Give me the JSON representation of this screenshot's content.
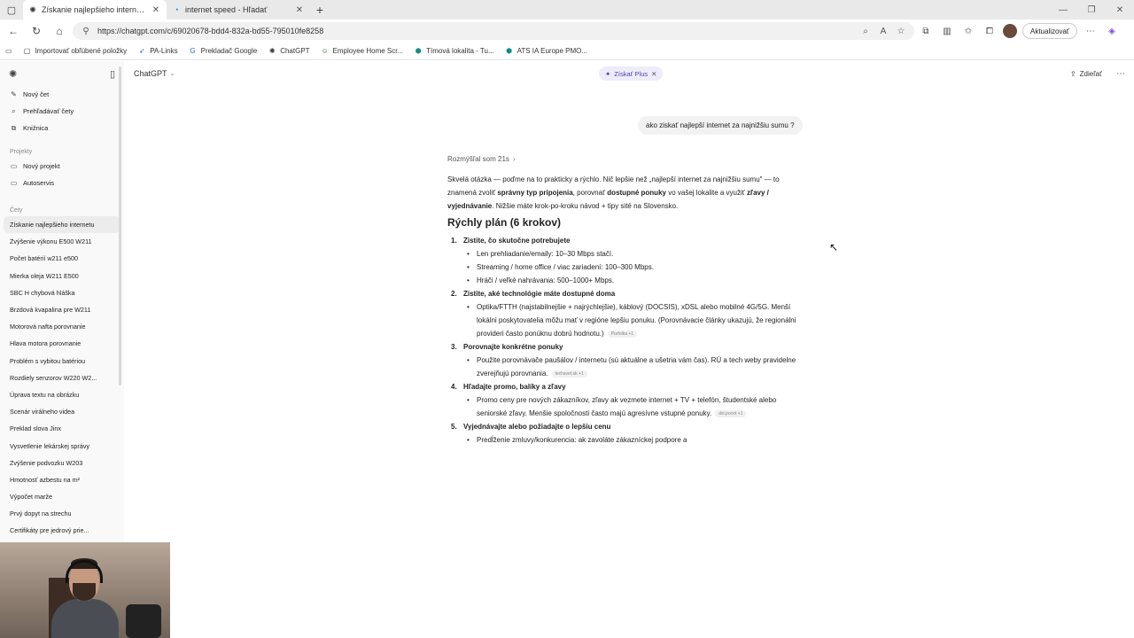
{
  "browser": {
    "tabs": [
      {
        "title": "Získanie najlepšieho internetu",
        "active": true
      },
      {
        "title": "internet speed - Hľadať",
        "active": false
      }
    ],
    "url": "https://chatgpt.com/c/69020678-bdd4-832a-bd55-795010fe8258",
    "update_label": "Aktualizovať"
  },
  "bookmarks": [
    {
      "label": "Importovať obľúbené položky",
      "icon": "folder-icon"
    },
    {
      "label": "PA-Links",
      "icon": "pa-icon"
    },
    {
      "label": "Prekladač Google",
      "icon": "translate-icon"
    },
    {
      "label": "ChatGPT",
      "icon": "chatgpt-icon"
    },
    {
      "label": "Employee Home Scr...",
      "icon": "person-icon"
    },
    {
      "label": "Tímová lokalita - Tu...",
      "icon": "team-icon"
    },
    {
      "label": "ATS IA Europe PMO...",
      "icon": "team-icon"
    }
  ],
  "sidebar": {
    "actions": [
      {
        "label": "Nový čet",
        "icon": "edit-icon"
      },
      {
        "label": "Prehľadávať čety",
        "icon": "search-icon"
      },
      {
        "label": "Knižnica",
        "icon": "library-icon"
      }
    ],
    "projects_heading": "Projekty",
    "projects": [
      {
        "label": "Nový projekt",
        "icon": "folder-plus-icon"
      },
      {
        "label": "Autoservis",
        "icon": "folder-icon"
      }
    ],
    "chats_heading": "Čety",
    "chats": [
      "Získanie najlepšieho internetu",
      "Zvýšenie výkonu E500 W211",
      "Počet batérií w211 e500",
      "Mierka oleja W211 E500",
      "SBC H chybová hláška",
      "Brzdová kvapalina pre W211",
      "Motorová nafta porovnanie",
      "Hlava motora porovnanie",
      "Problém s vybitou batériou",
      "Rozdiely senzorov W220 W2...",
      "Úprava textu na obrázku",
      "Scenár virálneho videa",
      "Preklad slova Jinx",
      "Vysvetlenie lekárskej správy",
      "Zvýšenie podvozku W203",
      "Hmotnosť azbestu na m²",
      "Výpočet marže",
      "Prvý dopyt na strechu",
      "Certifikáty pre jedrový prie..."
    ]
  },
  "header": {
    "model": "ChatGPT",
    "plus_label": "Získať Plus",
    "share_label": "Zdieľať"
  },
  "conversation": {
    "user_message": "ako ziskať najlepší internet za najnižšiu sumu ?",
    "thought": "Rozmýšľal som 21s",
    "intro_1": "Skvelá otázka — poďme na to prakticky a rýchlo. Nič lepšie než „najlepší internet za najnižšiu sumu\" — to znamená zvoliť ",
    "intro_b1": "správny typ pripojenia",
    "intro_2": ", porovnať ",
    "intro_b2": "dostupné ponuky",
    "intro_3": " vo vašej lokalite a využiť ",
    "intro_b3": "zľavy / vyjednávanie",
    "intro_4": ". Nižšie máte krok-po-kroku návod + tipy sité na Slovensko.",
    "plan_heading": "Rýchly plán (6 krokov)",
    "steps": [
      {
        "num": "1.",
        "title": "Zistite, čo skutočne potrebujete",
        "bullets": [
          {
            "text": "Len prehliadanie/emaily: 10–30 Mbps stačí.",
            "cite": ""
          },
          {
            "text": "Streaming / home office / viac zariadení: 100–300 Mbps.",
            "cite": ""
          },
          {
            "text": "Hráči / veľké nahrávania: 500–1000+ Mbps.",
            "cite": ""
          }
        ]
      },
      {
        "num": "2.",
        "title": "Zistite, aké technológie máte dostupné doma",
        "bullets": [
          {
            "text": "Optika/FTTH (najstabilnejšie + najrýchlejšie), káblový (DOCSIS), xDSL alebo mobilné 4G/5G. Menší lokálni poskytovatelia môžu mať v regióne lepšiu ponuku. (Porovnávacie články ukazujú, že regionálni provideri často ponúknu dobrú hodnotu.)",
            "cite": "Porfolka +1"
          }
        ]
      },
      {
        "num": "3.",
        "title": "Porovnajte konkrétne ponuky",
        "bullets": [
          {
            "text": "Použite porovnávače paušálov / internetu (sú aktuálne a ušetria vám čas). RÚ a tech weby pravidelne zverejňujú porovnania.",
            "cite": "techsvet.sk +1"
          }
        ]
      },
      {
        "num": "4.",
        "title": "Hľadajte promo, balíky a zľavy",
        "bullets": [
          {
            "text": "Promo ceny pre nových zákazníkov, zľavy ak vezmete internet + TV + telefón, študentské alebo seniorské zľavy. Menšie spoločnosti často majú agresívne vstupné ponuky.",
            "cite": "dsl.pocet +1"
          }
        ]
      },
      {
        "num": "5.",
        "title": "Vyjednávajte alebo požiadajte o lepšiu cenu",
        "bullets": [
          {
            "text": "Predĺženie zmluvy/konkurencia: ak zavoláte zákazníckej podpore a",
            "cite": ""
          }
        ]
      }
    ]
  }
}
